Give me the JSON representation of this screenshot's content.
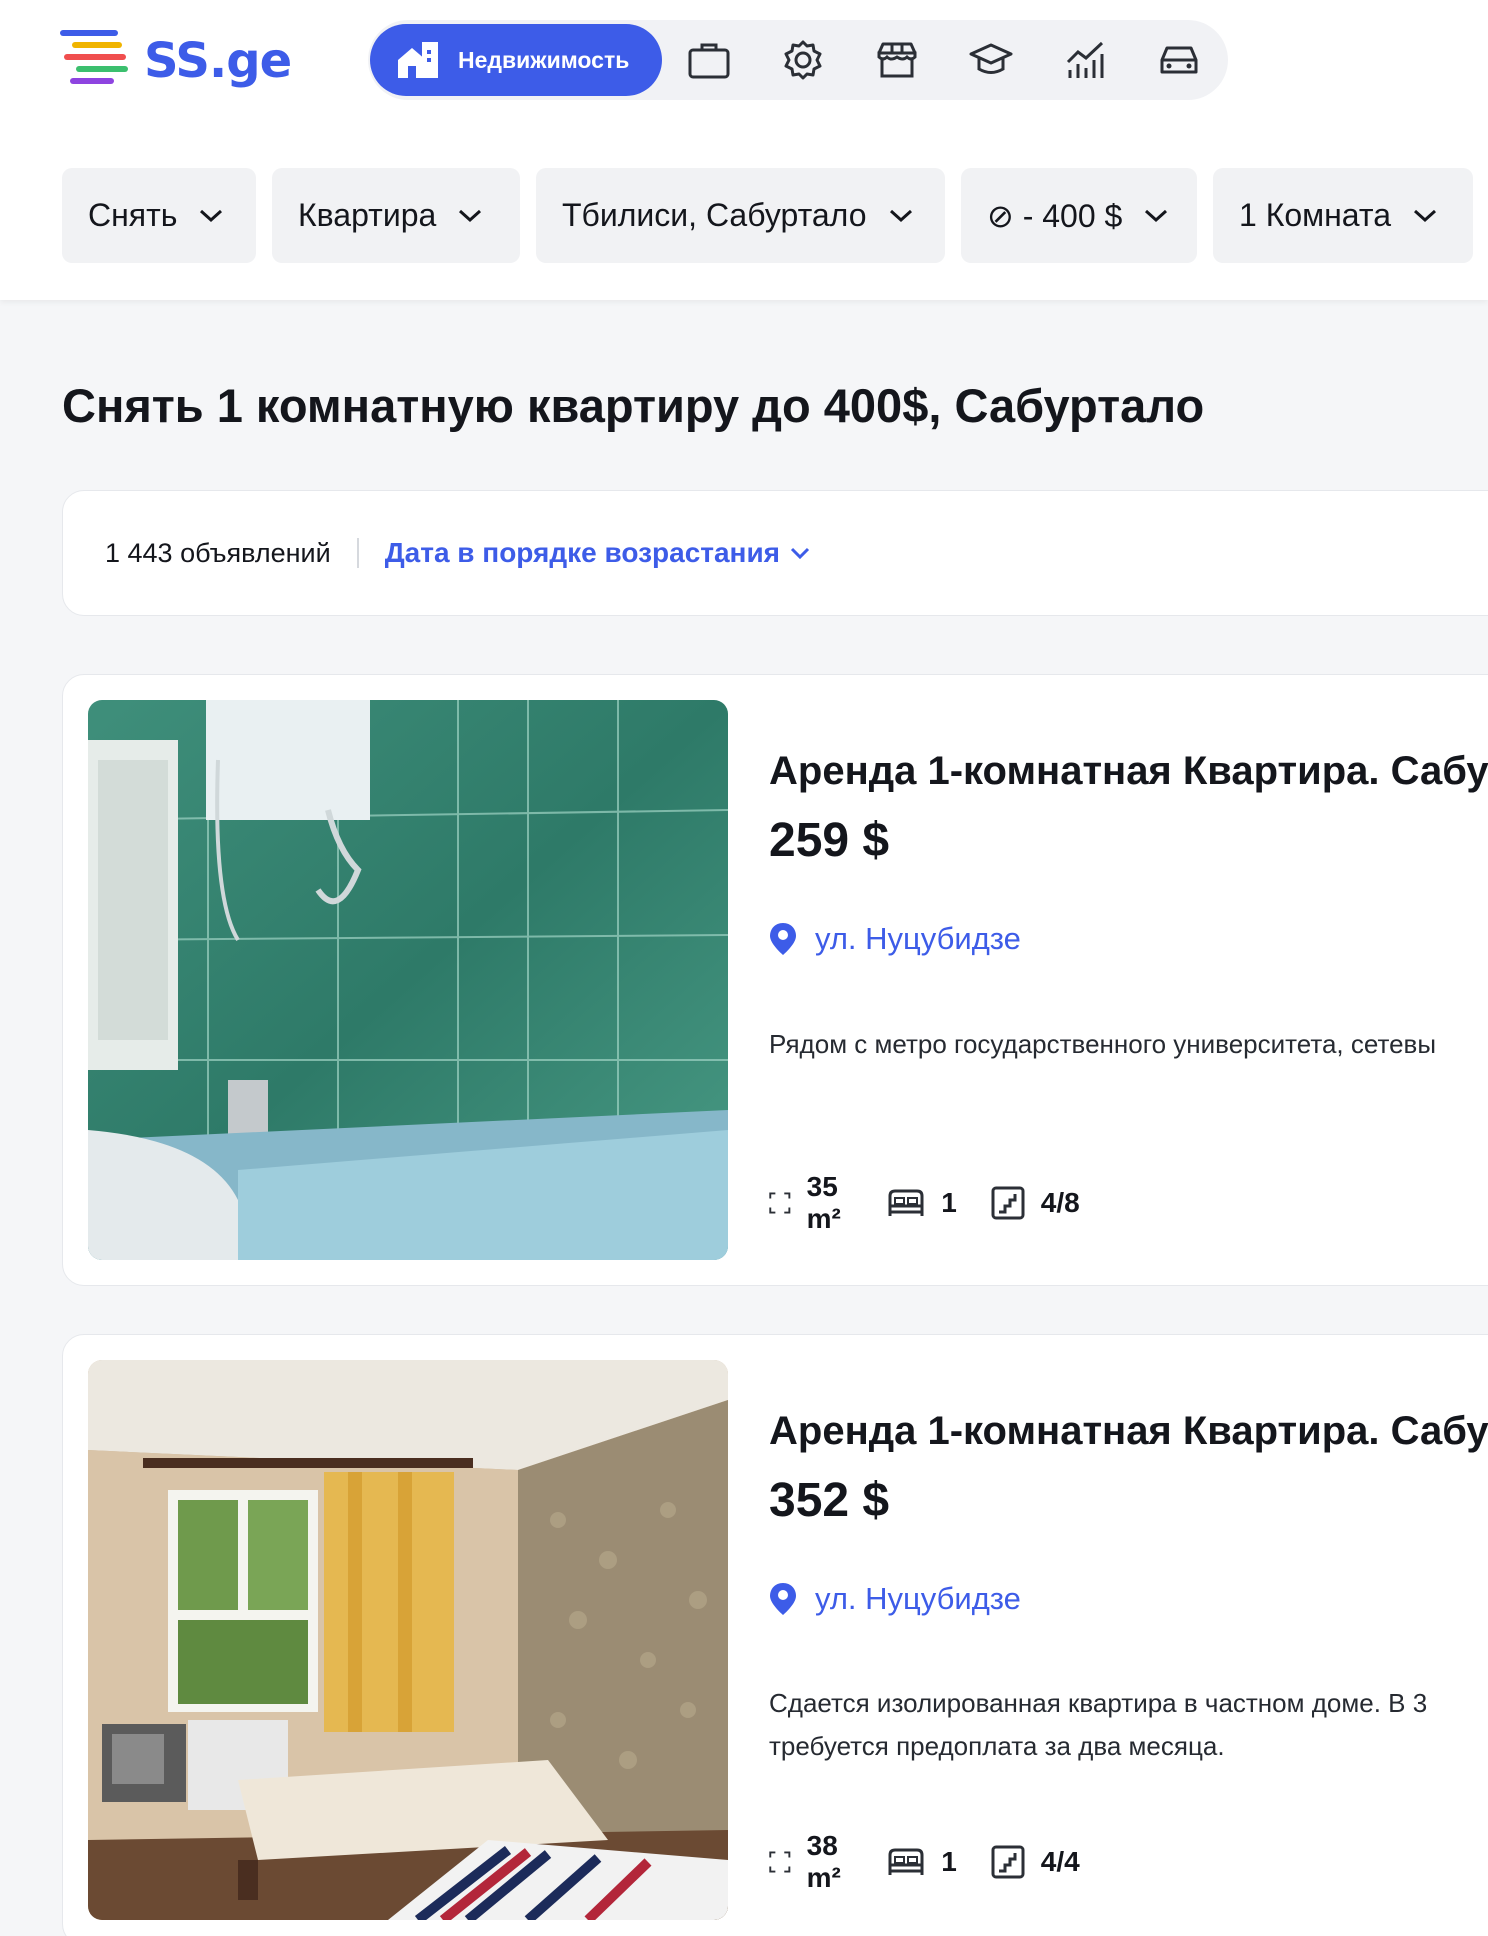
{
  "brand": {
    "name": "SS.ge"
  },
  "categories": {
    "active_label": "Недвижимость",
    "icons": [
      "briefcase-icon",
      "gear-icon",
      "store-icon",
      "graduation-cap-icon",
      "stats-chart-icon",
      "car-icon"
    ]
  },
  "filters": [
    {
      "label": "Снять"
    },
    {
      "label": "Квартира"
    },
    {
      "label": "Тбилиси, Сабуртало"
    },
    {
      "label": "⊘ - 400 $"
    },
    {
      "label": "1 Комната"
    }
  ],
  "page_title": "Снять 1 комнатную квартиру до 400$, Сабуртало",
  "results": {
    "count": "1 443 объявлений",
    "sort_label": "Дата в порядке возрастания"
  },
  "listings": [
    {
      "title": "Аренда 1-комнатная Квартира. Сабу",
      "price": "259 $",
      "address": "ул. Нуцубидзе",
      "description": "Рядом с метро государственного университета, сетевы",
      "area": "35 m²",
      "bedrooms": "1",
      "floor": "4/8"
    },
    {
      "title": "Аренда 1-комнатная Квартира. Сабу",
      "price": "352 $",
      "address": "ул. Нуцубидзе",
      "description": "Сдается изолированная квартира в частном доме. В 3\nтребуется предоплата за два месяца.",
      "area": "38 m²",
      "bedrooms": "1",
      "floor": "4/4"
    }
  ],
  "colors": {
    "accent": "#3d5ce8",
    "text": "#14161c",
    "page_bg": "#f5f6f8"
  }
}
